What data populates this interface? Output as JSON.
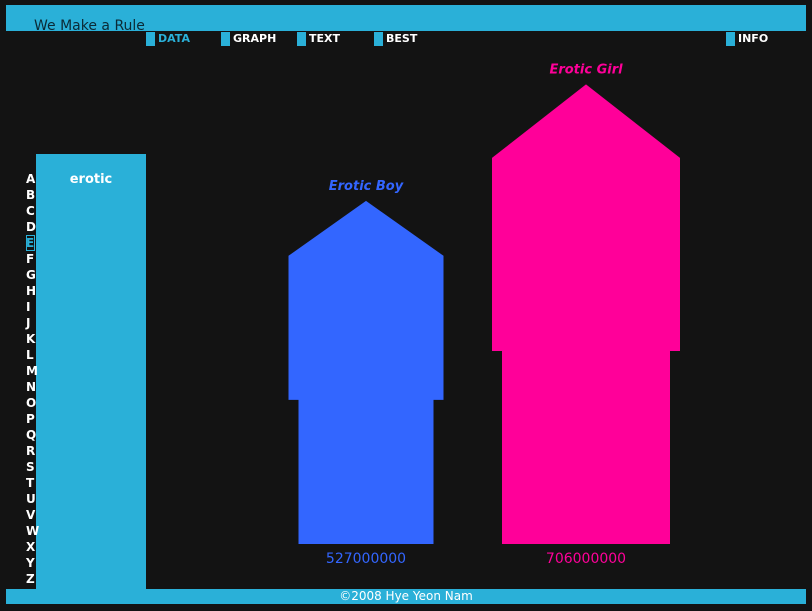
{
  "site": {
    "title": "We Make a Rule",
    "footer": "©2008 Hye Yeon Nam"
  },
  "nav": {
    "active": "DATA",
    "tabs": [
      {
        "label": "DATA"
      },
      {
        "label": "GRAPH"
      },
      {
        "label": "TEXT"
      },
      {
        "label": "BEST"
      },
      {
        "label": "INFO"
      }
    ]
  },
  "sidebar": {
    "term": "erotic",
    "letters": [
      "A",
      "B",
      "C",
      "D",
      "E",
      "F",
      "G",
      "H",
      "I",
      "J",
      "K",
      "L",
      "M",
      "N",
      "O",
      "P",
      "Q",
      "R",
      "S",
      "T",
      "U",
      "V",
      "W",
      "X",
      "Y",
      "Z"
    ],
    "selected_letter": "E"
  },
  "chart_data": {
    "type": "bar",
    "categories": [
      "Erotic Boy",
      "Erotic Girl"
    ],
    "values": [
      527000000,
      706000000
    ],
    "value_labels": [
      "527000000",
      "706000000"
    ],
    "colors": [
      "#3366ff",
      "#ff0099"
    ],
    "title": "",
    "xlabel": "",
    "ylabel": ""
  },
  "colors": {
    "accent": "#2ab0d8",
    "background": "#131313"
  }
}
